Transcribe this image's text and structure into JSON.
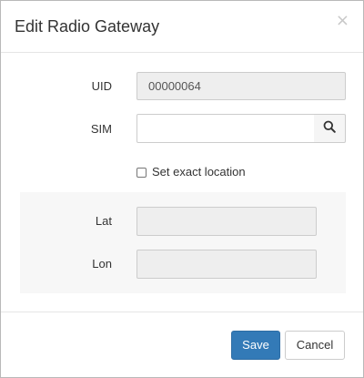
{
  "dialog": {
    "title": "Edit Radio Gateway",
    "close_glyph": "×"
  },
  "form": {
    "uid": {
      "label": "UID",
      "value": "00000064"
    },
    "sim": {
      "label": "SIM",
      "value": "",
      "placeholder": ""
    },
    "exact_location": {
      "label": "Set exact location",
      "checked": false
    },
    "lat": {
      "label": "Lat",
      "value": ""
    },
    "lon": {
      "label": "Lon",
      "value": ""
    }
  },
  "footer": {
    "save_label": "Save",
    "cancel_label": "Cancel"
  },
  "colors": {
    "primary": "#337ab7",
    "panel_bg": "#f7f7f7",
    "readonly_bg": "#eeeeee"
  },
  "icons": {
    "search": "search-icon",
    "close": "close-icon"
  }
}
